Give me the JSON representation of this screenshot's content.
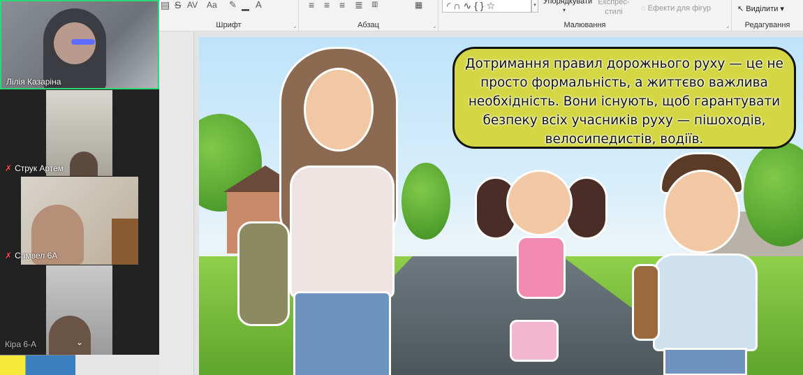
{
  "ribbon": {
    "groups": {
      "font": "Шрифт",
      "paragraph": "Абзац",
      "drawing": "Малювання",
      "editing": "Редагування"
    },
    "arrange_label": "Упорядкувати",
    "quick_styles_label": "Експрес-стилі",
    "shape_effects_label": "Ефекти для фігур",
    "select_label": "Виділити",
    "font_glyphs": {
      "strike": "S",
      "spacing": "AV",
      "case": "Aa",
      "color": "A"
    },
    "shapes_preview": "◜∩∿{}☆"
  },
  "slide": {
    "bubble_text": "Дотримання правил дорожнього руху — це не просто формальність, а життєво важлива необхідність. Вони існують, щоб гарантувати безпеку всіх учасників руху — пішоходів, велосипедистів, водіїв."
  },
  "participants": [
    {
      "name": "Лілія Казаріна",
      "muted": false,
      "active": true
    },
    {
      "name": "Струк Артем",
      "muted": true,
      "active": false
    },
    {
      "name": "Самвел 6А",
      "muted": true,
      "active": false
    },
    {
      "name": "Кіра 6-А",
      "muted": false,
      "active": false
    }
  ],
  "icons": {
    "mute": "mic-muted-icon",
    "expand": "chevron-down-icon"
  },
  "colors": {
    "active_speaker": "#2ed67a",
    "bubble_fill": "#d4d743",
    "muted_icon": "#ff4d4d"
  }
}
